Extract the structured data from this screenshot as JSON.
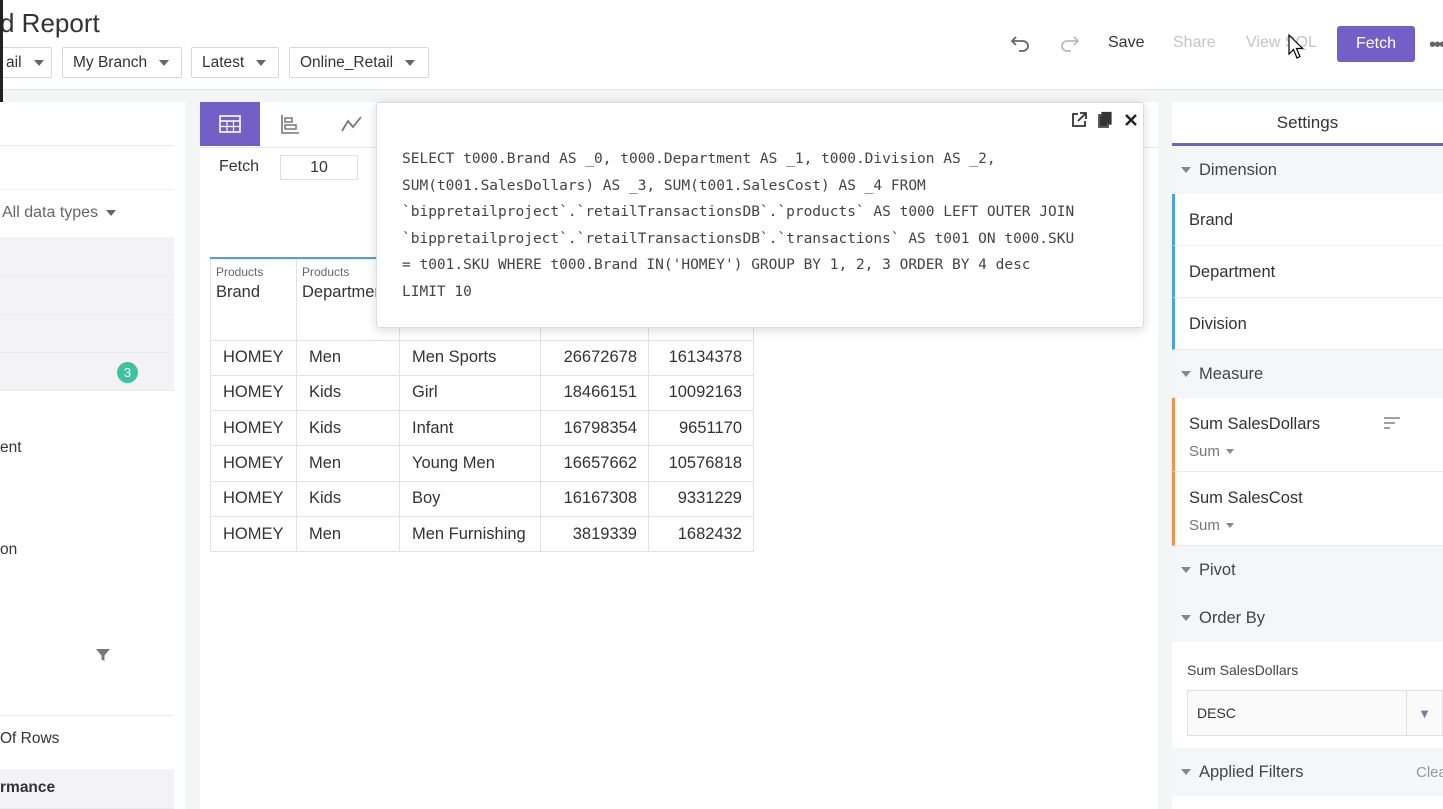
{
  "header": {
    "title": "d Report",
    "filters": [
      "ail",
      "My Branch",
      "Latest",
      "Online_Retail"
    ],
    "save_label": "Save",
    "share_label": "Share",
    "view_sql_label": "View SQL",
    "fetch_label": "Fetch",
    "more_label": "•••"
  },
  "left_panel": {
    "data_types_label": "All data types",
    "badge_count": "3",
    "partial_labels": [
      "ent",
      "on"
    ],
    "count_rows_label": "Of Rows",
    "performance_label": "rmance"
  },
  "center": {
    "fetch_label": "Fetch",
    "fetch_value": "10",
    "columns": [
      {
        "group": "Products",
        "name": "Brand"
      },
      {
        "group": "Products",
        "name": "Department"
      },
      {
        "group": "",
        "name": ""
      },
      {
        "group": "",
        "name": ""
      },
      {
        "group": "",
        "name": ""
      }
    ],
    "rows": [
      [
        "HOMEY",
        "Men",
        "Men Sports",
        "26672678",
        "16134378"
      ],
      [
        "HOMEY",
        "Kids",
        "Girl",
        "18466151",
        "10092163"
      ],
      [
        "HOMEY",
        "Kids",
        "Infant",
        "16798354",
        "9651170"
      ],
      [
        "HOMEY",
        "Men",
        "Young Men",
        "16657662",
        "10576818"
      ],
      [
        "HOMEY",
        "Kids",
        "Boy",
        "16167308",
        "9331229"
      ],
      [
        "HOMEY",
        "Men",
        "Men Furnishing",
        "3819339",
        "1682432"
      ]
    ]
  },
  "sql_popover": {
    "sql": "SELECT t000.Brand AS _0, t000.Department AS _1, t000.Division AS _2,\nSUM(t001.SalesDollars) AS _3, SUM(t001.SalesCost) AS _4 FROM\n`bippretailproject`.`retailTransactionsDB`.`products` AS t000 LEFT OUTER JOIN\n`bippretailproject`.`retailTransactionsDB`.`transactions` AS t001 ON t000.SKU\n= t001.SKU WHERE t000.Brand IN('HOMEY') GROUP BY 1, 2, 3 ORDER BY 4 desc\nLIMIT 10"
  },
  "settings": {
    "title": "Settings",
    "dimension_label": "Dimension",
    "dimensions": [
      "Brand",
      "Department",
      "Division"
    ],
    "measure_label": "Measure",
    "measures": [
      {
        "name": "Sum SalesDollars",
        "agg": "Sum"
      },
      {
        "name": "Sum SalesCost",
        "agg": "Sum"
      }
    ],
    "pivot_label": "Pivot",
    "order_by_label": "Order By",
    "order_field": "Sum SalesDollars",
    "order_value": "DESC",
    "applied_filters_label": "Applied Filters",
    "clear_label": "Clea"
  },
  "colors": {
    "accent": "#7360c7",
    "dimension": "#4aa3df",
    "measure": "#f0924b",
    "badge": "#3fc1a3"
  }
}
